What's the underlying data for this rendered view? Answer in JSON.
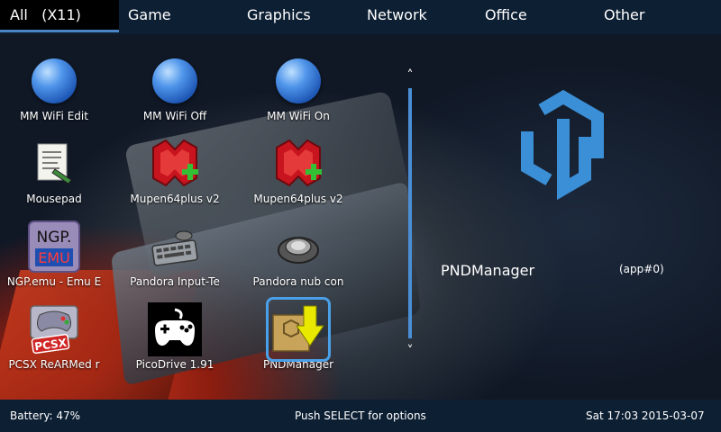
{
  "tabs": [
    {
      "label": "All   (X11)",
      "active": true
    },
    {
      "label": "Game",
      "active": false
    },
    {
      "label": "Graphics",
      "active": false
    },
    {
      "label": "Network",
      "active": false
    },
    {
      "label": "Office",
      "active": false
    },
    {
      "label": "Other",
      "active": false
    }
  ],
  "apps": [
    {
      "label": "MM WiFi Edit",
      "icon": "globe-icon"
    },
    {
      "label": "MM WiFi Off",
      "icon": "globe-icon"
    },
    {
      "label": "MM WiFi On",
      "icon": "globe-icon"
    },
    {
      "label": "Mousepad",
      "icon": "notepad-icon"
    },
    {
      "label": "Mupen64plus v2",
      "icon": "mupen64-icon"
    },
    {
      "label": "Mupen64plus v2",
      "icon": "mupen64-icon"
    },
    {
      "label": "NGP.emu - Emu E",
      "icon": "ngp-emu-icon",
      "icon_text": [
        "NGP.",
        "EMU"
      ]
    },
    {
      "label": "Pandora Input-Te",
      "icon": "keyboard-icon"
    },
    {
      "label": "Pandora nub con",
      "icon": "nub-icon"
    },
    {
      "label": "PCSX ReARMed r",
      "icon": "pcsx-icon",
      "icon_text": "PCSX"
    },
    {
      "label": "PicoDrive 1.91",
      "icon": "gamepad-icon"
    },
    {
      "label": "PNDManager",
      "icon": "pndmanager-icon",
      "selected": true
    }
  ],
  "scroll": {
    "up": "˄",
    "down": "˅"
  },
  "info": {
    "name": "PNDManager",
    "id": "(app#0)"
  },
  "footer": {
    "battery": "Battery: 47%",
    "hint": "Push SELECT for options",
    "clock": "Sat 17:03 2015-03-07"
  },
  "colors": {
    "accent": "#4a86c5",
    "bar": "#0d1f33",
    "logo": "#3b8fd6"
  }
}
